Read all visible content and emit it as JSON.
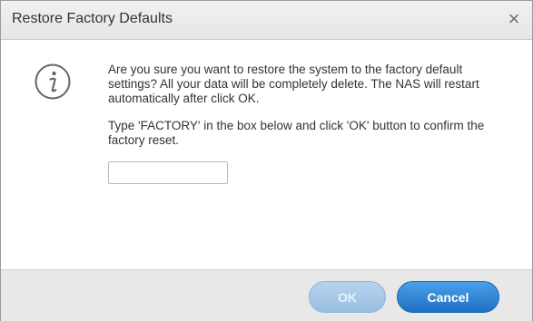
{
  "dialog": {
    "title": "Restore Factory Defaults",
    "close_icon": "×",
    "info_icon": "information-icon",
    "message_line1": "Are you sure you want to restore the system to the factory default settings? All your data will be completely delete. The NAS will restart automatically after click OK.",
    "message_line2": "Type 'FACTORY' in the box below and click 'OK' button to confirm the factory reset.",
    "input_value": "",
    "input_placeholder": "",
    "ok_label": "OK",
    "cancel_label": "Cancel"
  }
}
